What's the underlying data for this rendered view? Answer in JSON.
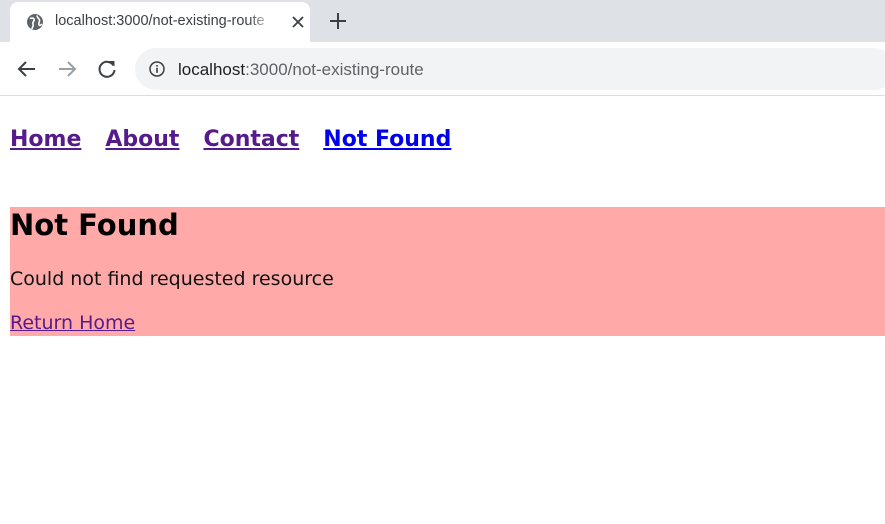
{
  "browser": {
    "tab": {
      "title": "localhost:3000/not-existing-route"
    },
    "address_bar": {
      "host": "localhost",
      "rest": ":3000/not-existing-route"
    }
  },
  "page": {
    "nav": [
      {
        "label": "Home",
        "visited": true
      },
      {
        "label": "About",
        "visited": true
      },
      {
        "label": "Contact",
        "visited": true
      },
      {
        "label": "Not Found",
        "visited": false
      }
    ],
    "not_found": {
      "heading": "Not Found",
      "message": "Could not find requested resource",
      "link_label": "Return Home",
      "background": "#ffa9a9"
    }
  },
  "icons": [
    "globe-icon",
    "close-icon",
    "plus-icon",
    "back-arrow-icon",
    "forward-arrow-icon",
    "reload-icon",
    "info-icon"
  ]
}
